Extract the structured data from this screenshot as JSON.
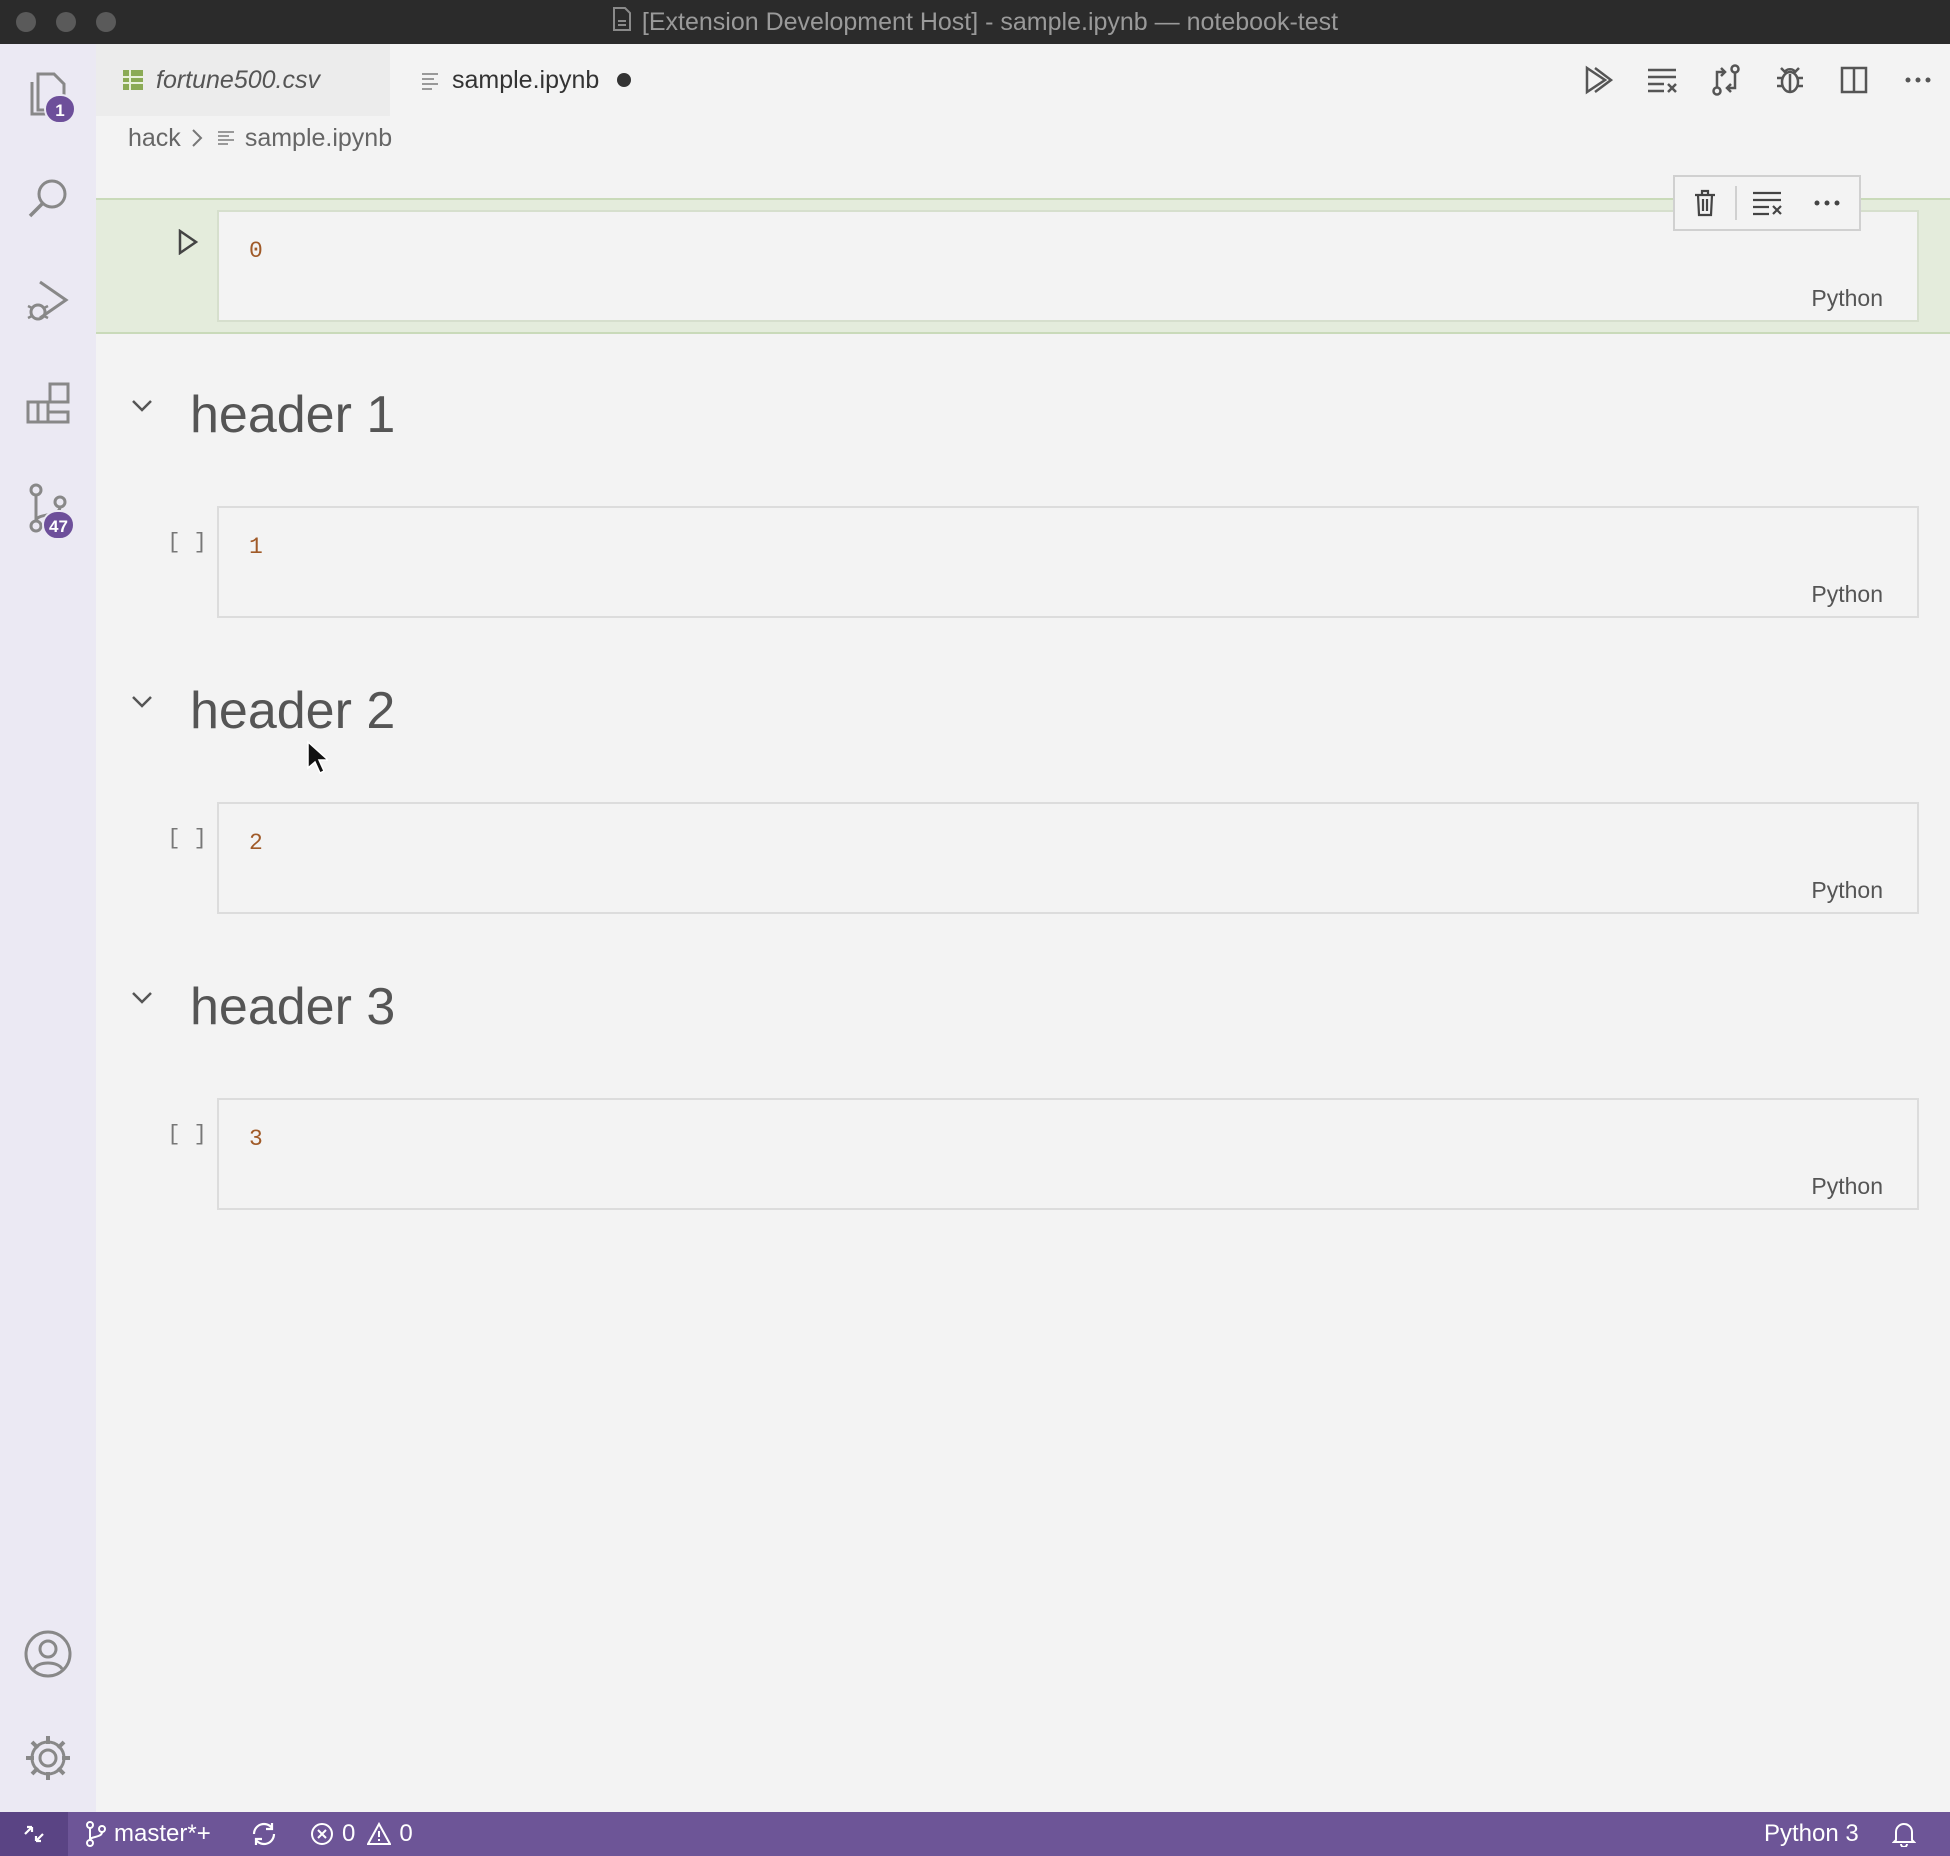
{
  "window": {
    "title": "[Extension Development Host] - sample.ipynb — notebook-test"
  },
  "activity_bar": {
    "explorer_badge": "1",
    "source_control_badge": "47"
  },
  "tabs": [
    {
      "label": "fortune500.csv",
      "icon": "spreadsheet-icon",
      "active": false
    },
    {
      "label": "sample.ipynb",
      "icon": "notebook-file-icon",
      "active": true,
      "dirty": true
    }
  ],
  "breadcrumb": {
    "folder": "hack",
    "file": "sample.ipynb"
  },
  "cells": [
    {
      "type": "code",
      "source": "0",
      "language": "Python",
      "selected": true
    },
    {
      "type": "markdown",
      "text": "header 1"
    },
    {
      "type": "code",
      "source": "1",
      "language": "Python",
      "exec_count": "[ ]"
    },
    {
      "type": "markdown",
      "text": "header 2"
    },
    {
      "type": "code",
      "source": "2",
      "language": "Python",
      "exec_count": "[ ]"
    },
    {
      "type": "markdown",
      "text": "header 3"
    },
    {
      "type": "code",
      "source": "3",
      "language": "Python",
      "exec_count": "[ ]"
    }
  ],
  "status_bar": {
    "branch": "master*+",
    "errors": "0",
    "warnings": "0",
    "kernel": "Python 3"
  },
  "colors": {
    "status_bar": "#6d5597",
    "badge": "#6d4f9a",
    "selected_cell": "#e4ecdc",
    "code_number": "#a05a28"
  }
}
